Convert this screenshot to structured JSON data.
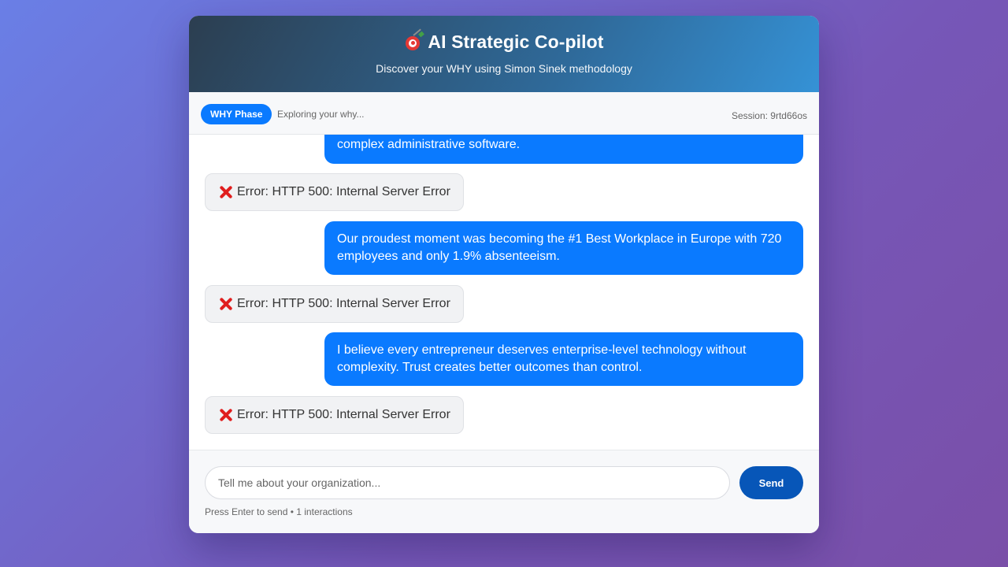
{
  "header": {
    "icon": "target-dart-icon",
    "title": "AI Strategic Co-pilot",
    "subtitle": "Discover your WHY using Simon Sinek methodology"
  },
  "phase_bar": {
    "badge": "WHY Phase",
    "status": "Exploring your why...",
    "session": "Session: 9rtd66os"
  },
  "messages": [
    {
      "role": "user",
      "text": "complex administrative software."
    },
    {
      "role": "error",
      "icon": "x-icon",
      "text": "Error: HTTP 500: Internal Server Error"
    },
    {
      "role": "user",
      "text": "Our proudest moment was becoming the #1 Best Workplace in Europe with 720 employees and only 1.9% absenteeism."
    },
    {
      "role": "error",
      "icon": "x-icon",
      "text": "Error: HTTP 500: Internal Server Error"
    },
    {
      "role": "user",
      "text": "I believe every entrepreneur deserves enterprise-level technology without complexity. Trust creates better outcomes than control."
    },
    {
      "role": "error",
      "icon": "x-icon",
      "text": "Error: HTTP 500: Internal Server Error"
    }
  ],
  "composer": {
    "placeholder": "Tell me about your organization...",
    "value": "",
    "send_label": "Send",
    "hint": "Press Enter to send • 1 interactions"
  },
  "colors": {
    "accent": "#0a7aff",
    "send_button": "#0756b8",
    "error_icon": "#e01e1e"
  }
}
